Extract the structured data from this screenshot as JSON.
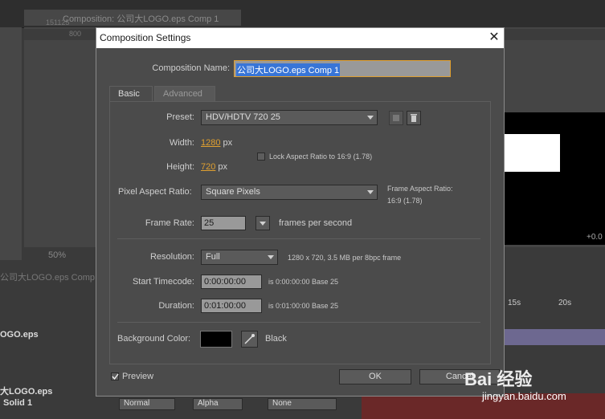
{
  "background": {
    "tab_title": "Composition: 公司大LOGO.eps Comp 1",
    "timecode": "151125",
    "ruler_mark": "800",
    "zoom": "50%",
    "timeline_tab": "公司大LOGO.eps Comp",
    "time_15s": "15s",
    "time_20s": "20s",
    "layer1": "OGO.eps",
    "layer2": "大LOGO.eps",
    "layer3": "Solid 1",
    "mode_normal": "Normal",
    "mode_alpha": "Alpha",
    "mode_none": "None",
    "offset": "+0.0"
  },
  "dialog": {
    "title": "Composition Settings",
    "composition_name_label": "Composition Name:",
    "composition_name_value": "公司大LOGO.eps Comp 1",
    "tabs": [
      {
        "label": "Basic",
        "active": true
      },
      {
        "label": "Advanced",
        "active": false
      }
    ],
    "preset_label": "Preset:",
    "preset_value": "HDV/HDTV 720 25",
    "width_label": "Width:",
    "width_value": "1280",
    "width_unit": "px",
    "height_label": "Height:",
    "height_value": "720",
    "height_unit": "px",
    "lock_aspect_label": "Lock Aspect Ratio to 16:9 (1.78)",
    "pixel_aspect_label": "Pixel Aspect Ratio:",
    "pixel_aspect_value": "Square Pixels",
    "frame_aspect_label": "Frame Aspect Ratio:",
    "frame_aspect_value": "16:9 (1.78)",
    "frame_rate_label": "Frame Rate:",
    "frame_rate_value": "25",
    "frame_rate_unit": "frames per second",
    "resolution_label": "Resolution:",
    "resolution_value": "Full",
    "resolution_info": "1280 x 720, 3.5 MB per 8bpc frame",
    "start_timecode_label": "Start Timecode:",
    "start_timecode_value": "0:00:00:00",
    "start_timecode_info": "is 0:00:00:00  Base 25",
    "duration_label": "Duration:",
    "duration_value": "0:01:00:00",
    "duration_info": "is 0:01:00:00  Base 25",
    "background_color_label": "Background Color:",
    "background_color_name": "Black",
    "background_color_hex": "#000000",
    "preview_label": "Preview",
    "ok_label": "OK",
    "cancel_label": "Cancel"
  },
  "watermark": {
    "brand": "Bai 经验",
    "url": "jingyan.baidu.com"
  }
}
